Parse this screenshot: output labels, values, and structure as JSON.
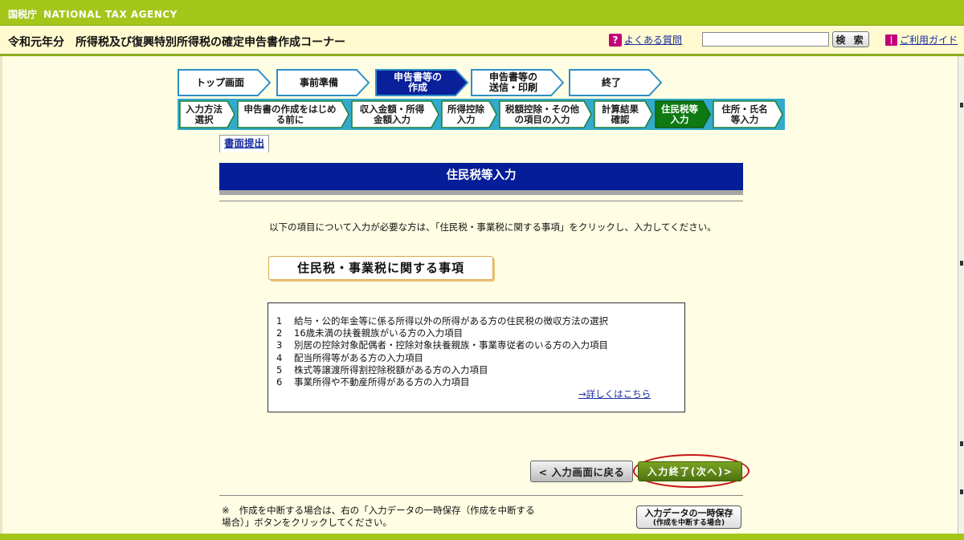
{
  "agency": {
    "jp": "国税庁",
    "en": "NATIONAL TAX AGENCY"
  },
  "header": {
    "year": "令和元年分",
    "title": "所得税及び復興特別所得税の確定申告書作成コーナー",
    "faq_label": "よくある質問",
    "search_value": "",
    "search_button": "検 索",
    "guide_label": "ご利用ガイド"
  },
  "steps": [
    {
      "label": "トップ画面",
      "state": "default"
    },
    {
      "label": "事前準備",
      "state": "default"
    },
    {
      "label": "申告書等の\n作成",
      "state": "active"
    },
    {
      "label": "申告書等の\n送信・印刷",
      "state": "default"
    },
    {
      "label": "終了",
      "state": "default"
    }
  ],
  "substeps": [
    {
      "label": "入力方法\n選択",
      "state": "default"
    },
    {
      "label": "申告書の作成をはじめ\nる前に",
      "state": "default"
    },
    {
      "label": "収入金額・所得\n金額入力",
      "state": "default"
    },
    {
      "label": "所得控除\n入力",
      "state": "default"
    },
    {
      "label": "税額控除・その他\nの項目の入力",
      "state": "default"
    },
    {
      "label": "計算結果\n確認",
      "state": "default"
    },
    {
      "label": "住民税等\n入力",
      "state": "active"
    },
    {
      "label": "住所・氏名\n等入力",
      "state": "default"
    }
  ],
  "submit_tab": "書面提出",
  "section_title": "住民税等入力",
  "intro": "以下の項目について入力が必要な方は、「住民税・事業税に関する事項」をクリックし、入力してください。",
  "resident_tax_button": "住民税・事業税に関する事項",
  "info_items": [
    {
      "num": "1",
      "text": "給与・公的年金等に係る所得以外の所得がある方の住民税の徴収方法の選択"
    },
    {
      "num": "2",
      "text": "16歳未満の扶養親族がいる方の入力項目"
    },
    {
      "num": "3",
      "text": "別居の控除対象配偶者・控除対象扶養親族・事業専従者のいる方の入力項目"
    },
    {
      "num": "4",
      "text": "配当所得等がある方の入力項目"
    },
    {
      "num": "5",
      "text": "株式等譲渡所得割控除税額がある方の入力項目"
    },
    {
      "num": "6",
      "text": "事業所得や不動産所得がある方の入力項目"
    }
  ],
  "details_link": "→詳しくはこちら",
  "back_button": "< 入力画面に戻る",
  "next_button": "入力終了(次へ)>",
  "note_mark": "※",
  "note_text": "作成を中断する場合は、右の「入力データの一時保存（作成を中断する場合）」ボタンをクリックしてください。",
  "save_button": {
    "line1": "入力データの一時保存",
    "line2": "(作成を中断する場合)"
  },
  "colors": {
    "agency_bar": "#a4c61a",
    "header_bg": "#fffad0",
    "step_active": "#0a1f9a",
    "step_default_stroke": "#2d8fc8",
    "substep_active": "#0f7a12",
    "substep_default_stroke": "#1f7f39",
    "section_header": "#051d97",
    "next_button": "#5f8616",
    "highlight_ring": "#c41616"
  },
  "icons": {
    "faq": "question-icon",
    "guide": "book-icon"
  }
}
